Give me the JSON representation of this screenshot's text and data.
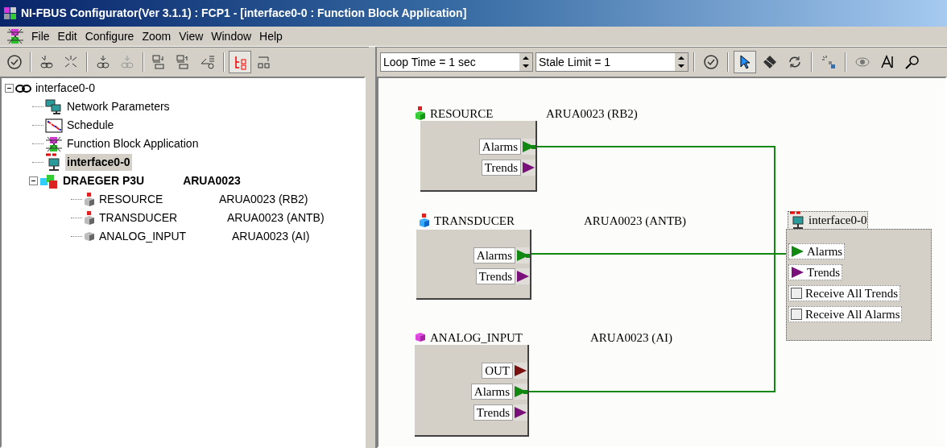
{
  "window": {
    "title": "NI-FBUS Configurator(Ver 3.1.1) : FCP1 - [interface0-0 : Function Block Application]"
  },
  "menu": [
    "File",
    "Edit",
    "Configure",
    "Zoom",
    "View",
    "Window",
    "Help"
  ],
  "tree": {
    "label": "interface0-0",
    "kind": "link",
    "expanded": true,
    "selected": false,
    "children": [
      {
        "label": "Network Parameters",
        "kind": "network",
        "selected": false
      },
      {
        "label": "Schedule",
        "kind": "schedule",
        "selected": false
      },
      {
        "label": "Function Block Application",
        "kind": "fba",
        "selected": false
      },
      {
        "label": "interface0-0",
        "kind": "interface",
        "selected": true
      },
      {
        "label": "DRAEGER P3U",
        "tag": "ARUA0023",
        "kind": "device",
        "expanded": true,
        "selected": false,
        "children": [
          {
            "label": "RESOURCE",
            "tag": "ARUA0023 (RB2)",
            "kind": "resource",
            "selected": false
          },
          {
            "label": "TRANSDUCER",
            "tag": "ARUA0023 (ANTB)",
            "kind": "transducer",
            "selected": false
          },
          {
            "label": "ANALOG_INPUT",
            "tag": "ARUA0023 (AI)",
            "kind": "ai",
            "selected": false
          }
        ]
      }
    ]
  },
  "canvas_toolbar": {
    "loop_time": "Loop Time = 1 sec",
    "stale_limit": "Stale Limit = 1"
  },
  "blocks": [
    {
      "name": "RESOURCE",
      "tag": "ARUA0023 (RB2)",
      "kind": "resource",
      "ports": [
        {
          "label": "Alarms",
          "kind": "alarm"
        },
        {
          "label": "Trends",
          "kind": "trend"
        }
      ]
    },
    {
      "name": "TRANSDUCER",
      "tag": "ARUA0023 (ANTB)",
      "kind": "transducer",
      "ports": [
        {
          "label": "Alarms",
          "kind": "alarm"
        },
        {
          "label": "Trends",
          "kind": "trend"
        }
      ]
    },
    {
      "name": "ANALOG_INPUT",
      "tag": "ARUA0023 (AI)",
      "kind": "ai",
      "ports": [
        {
          "label": "OUT",
          "kind": "out"
        },
        {
          "label": "Alarms",
          "kind": "alarm"
        },
        {
          "label": "Trends",
          "kind": "trend"
        }
      ]
    }
  ],
  "interface_block": {
    "title": "interface0-0",
    "items": [
      {
        "label": "Alarms",
        "kind": "alarm"
      },
      {
        "label": "Trends",
        "kind": "trend"
      },
      {
        "label": "Receive All Trends",
        "kind": "checkbox",
        "checked": false
      },
      {
        "label": "Receive All Alarms",
        "kind": "checkbox",
        "checked": false
      }
    ]
  }
}
